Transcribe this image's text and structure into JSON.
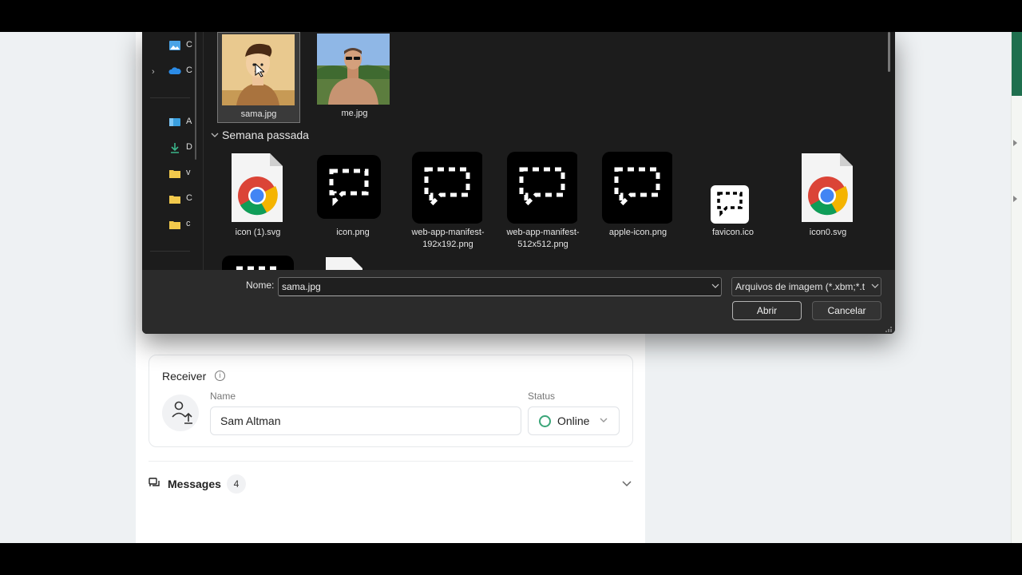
{
  "dialog": {
    "recent_files": [
      {
        "name": "sama.jpg",
        "selected": true
      },
      {
        "name": "me.jpg",
        "selected": false
      }
    ],
    "group_label": "Semana passada",
    "last_week_files": [
      {
        "name": "icon (1).svg",
        "icon": "chrome-file-icon"
      },
      {
        "name": "icon.png",
        "icon": "dashed-chat-icon"
      },
      {
        "name": "web-app-manifest-192x192.png",
        "icon": "dashed-chat-icon"
      },
      {
        "name": "web-app-manifest-512x512.png",
        "icon": "dashed-chat-icon"
      },
      {
        "name": "apple-icon.png",
        "icon": "dashed-chat-icon"
      },
      {
        "name": "favicon.ico",
        "icon": "dashed-chat-small-icon"
      },
      {
        "name": "icon0.svg",
        "icon": "chrome-file-icon"
      }
    ],
    "nav_items": [
      {
        "label": "C",
        "icon": "pictures-icon"
      },
      {
        "label": "C",
        "icon": "onedrive-icon"
      },
      {
        "label": "A",
        "icon": "desktop-icon"
      },
      {
        "label": "D",
        "icon": "download-icon"
      },
      {
        "label": "v",
        "icon": "folder-icon"
      },
      {
        "label": "C",
        "icon": "folder-icon"
      },
      {
        "label": "c",
        "icon": "folder-icon"
      }
    ],
    "filename_label": "Nome:",
    "filename_value": "sama.jpg",
    "filetype_value": "Arquivos de imagem (*.xbm;*.t",
    "open_label": "Abrir",
    "cancel_label": "Cancelar"
  },
  "receiver": {
    "title": "Receiver",
    "name_label": "Name",
    "name_value": "Sam Altman",
    "status_label": "Status",
    "status_value": "Online",
    "status_color": "#3aa578"
  },
  "messages": {
    "label": "Messages",
    "count": "4"
  }
}
